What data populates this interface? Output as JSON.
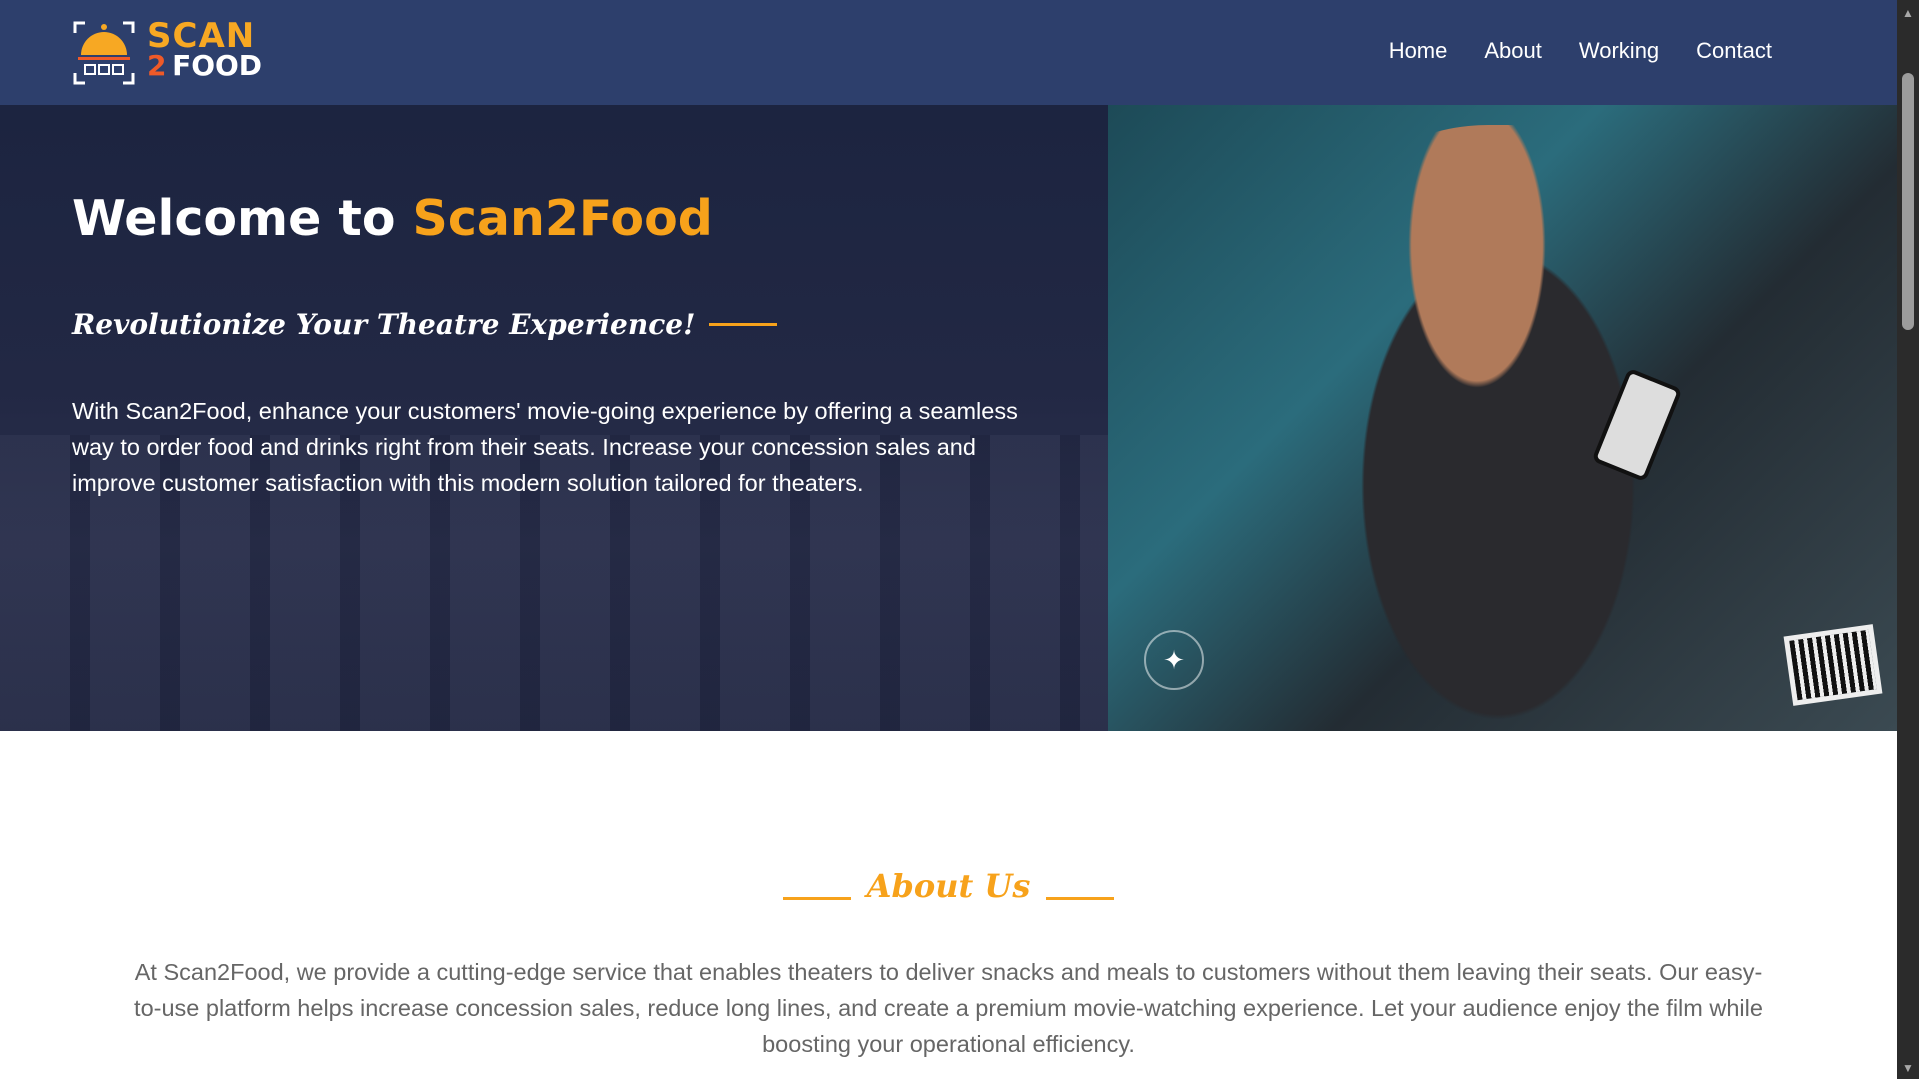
{
  "nav": {
    "logo_line1": "SCAN",
    "logo_line2_num": "2",
    "logo_line2_word": "FOOD",
    "links": [
      "Home",
      "About",
      "Working",
      "Contact"
    ]
  },
  "hero": {
    "title_prefix": "Welcome to ",
    "title_accent": "Scan2Food",
    "subtitle": "Revolutionize Your Theatre Experience!",
    "paragraph": "With Scan2Food, enhance your customers' movie-going experience by offering a seamless way to order food and drinks right from their seats. Increase your concession sales and improve customer satisfaction with this modern solution tailored for theaters."
  },
  "about": {
    "title": "About Us",
    "paragraph": "At Scan2Food, we provide a cutting-edge service that enables theaters to deliver snacks and meals to customers without them leaving their seats. Our easy-to-use platform helps increase concession sales, reduce long lines, and create a premium movie-watching experience. Let your audience enjoy the film while boosting your operational efficiency."
  },
  "colors": {
    "nav": "#2d3f6c",
    "accent": "#f7a21b"
  }
}
